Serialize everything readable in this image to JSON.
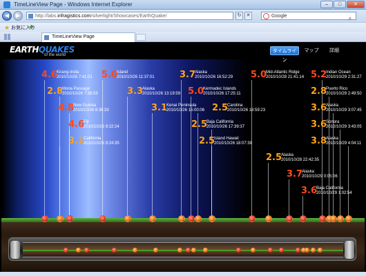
{
  "window": {
    "title": "TimeLineView Page - Windows Internet Explorer",
    "btn_min": "–",
    "btn_max": "□",
    "btn_close": "✕"
  },
  "address": {
    "url_prefix": "http://labs.",
    "url_host": "infragistics.com",
    "url_path": "/silverlight/Showcases/EarthQuake/",
    "search_text": "Google",
    "refresh": "↻",
    "stop": "✕"
  },
  "favorites": {
    "label": "お気に入り"
  },
  "tab": {
    "title": "TimeLineView Page"
  },
  "app": {
    "logo_earth": "EARTH",
    "logo_quakes": "QUAKES",
    "logo_sub": "of the world",
    "tabs": [
      {
        "label": "タイムライン",
        "active": true
      },
      {
        "label": "マップ",
        "active": false
      },
      {
        "label": "詳細",
        "active": false
      }
    ]
  },
  "quakes": [
    {
      "mag": "4.6",
      "place": "Kirang-India",
      "time": "2010/10/26 7:41:01",
      "color": "#ff4a1a"
    },
    {
      "mag": "2.8",
      "place": "Mona Passage",
      "time": "2010/10/26 7:56:53",
      "color": "#ffa31a"
    },
    {
      "mag": "4.8",
      "place": "New Guinea",
      "time": "2010/10/26 8:36:33",
      "color": "#ff4a1a"
    },
    {
      "mag": "4.6",
      "place": "Fiji",
      "time": "2010/10/26 9:22:24",
      "color": "#ff4a1a"
    },
    {
      "mag": "3.1",
      "place": "California",
      "time": "2010/10/26 9:24:35",
      "color": "#ffa31a"
    },
    {
      "mag": "5.0",
      "place": "Island",
      "time": "2010/10/26 11:37:01",
      "color": "#ff4a1a"
    },
    {
      "mag": "3.3",
      "place": "Alaska",
      "time": "2010/10/26 13:19:59",
      "color": "#ffa31a"
    },
    {
      "mag": "3.1",
      "place": "Kenai Peninsula",
      "time": "2010/10/26 15:00:06",
      "color": "#ffa31a"
    },
    {
      "mag": "3.7",
      "place": "Alaska",
      "time": "2010/10/26 16:52:29",
      "color": "#ffa31a"
    },
    {
      "mag": "5.0",
      "place": "Kermadec Islands",
      "time": "2010/10/26 17:25:11",
      "color": "#ff4a1a"
    },
    {
      "mag": "2.5",
      "place": "Carolina",
      "time": "2010/10/26 18:59:23",
      "color": "#ffa31a"
    },
    {
      "mag": "2.5",
      "place": "Baja California",
      "time": "2010/10/26 17:39:37",
      "color": "#ffa31a"
    },
    {
      "mag": "2.5",
      "place": "Island Hawaii",
      "time": "2010/10/26 18:07:38",
      "color": "#ffa31a"
    },
    {
      "mag": "5.0",
      "place": "Mid-Atlantic Ridge",
      "time": "2010/10/28 21:41:14",
      "color": "#ff4a1a"
    },
    {
      "mag": "2.5",
      "place": "Alaska",
      "time": "2010/10/28 22:42:35",
      "color": "#ffa31a"
    },
    {
      "mag": "3.7",
      "place": "Alaska",
      "time": "2010/10/29 0:05:06",
      "color": "#ff4a1a"
    },
    {
      "mag": "3.6",
      "place": "Baja California",
      "time": "2010/10/29 1:02:54",
      "color": "#ff4a1a"
    },
    {
      "mag": "5.2",
      "place": "Indian Ocean",
      "time": "2010/10/29 2:31:27",
      "color": "#ff4a1a"
    },
    {
      "mag": "2.8",
      "place": "Puerto Rico",
      "time": "2010/10/29 2:49:50",
      "color": "#ffa31a"
    },
    {
      "mag": "3.6",
      "place": "Alaska",
      "time": "2010/10/29 3:07:45",
      "color": "#ffa31a"
    },
    {
      "mag": "3.6",
      "place": "Sonora",
      "time": "2010/10/29 3:43:05",
      "color": "#ffa31a"
    },
    {
      "mag": "3.8",
      "place": "Alaska",
      "time": "2010/10/29 4:04:11",
      "color": "#ffa31a"
    }
  ]
}
